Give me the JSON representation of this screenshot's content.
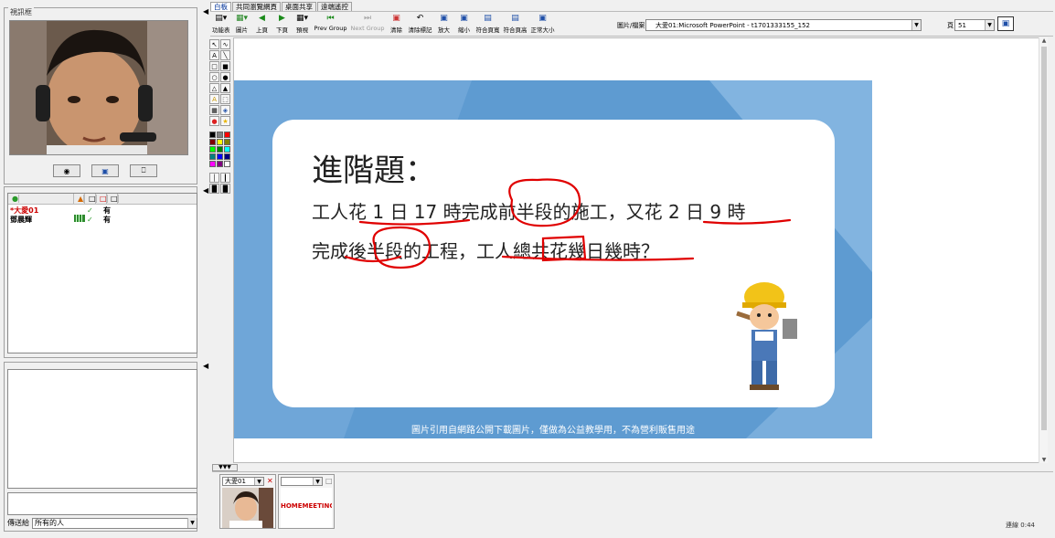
{
  "left": {
    "video_title": "視訊框",
    "users_header": [
      "",
      "",
      "",
      ""
    ],
    "users": [
      {
        "name": "*大愛01",
        "status": "有",
        "color": "#cc0000"
      },
      {
        "name": "鄧晨輝",
        "status": "有",
        "color": "#000000"
      }
    ],
    "to_label": "傳送給",
    "to_value": "所有的人"
  },
  "tabs": [
    {
      "label": "白板",
      "active": true
    },
    {
      "label": "共同瀏覽網頁",
      "active": false
    },
    {
      "label": "桌面共享",
      "active": false
    },
    {
      "label": "遠端遙控",
      "active": false
    }
  ],
  "toolbar": {
    "buttons": [
      {
        "label": "功能表",
        "icon": "menu-icon",
        "disabled": false
      },
      {
        "label": "圖片",
        "icon": "image-icon",
        "disabled": false
      },
      {
        "label": "上頁",
        "icon": "prev-page-icon",
        "disabled": false
      },
      {
        "label": "下頁",
        "icon": "next-page-icon",
        "disabled": false
      },
      {
        "label": "預視",
        "icon": "preview-icon",
        "disabled": false
      },
      {
        "label": "Prev Group",
        "icon": "prev-group-icon",
        "disabled": false
      },
      {
        "label": "Next Group",
        "icon": "next-group-icon",
        "disabled": true
      },
      {
        "label": "清除",
        "icon": "clear-icon",
        "disabled": false
      },
      {
        "label": "清除標記",
        "icon": "clear-marks-icon",
        "disabled": false
      },
      {
        "label": "放大",
        "icon": "zoom-in-icon",
        "disabled": false
      },
      {
        "label": "縮小",
        "icon": "zoom-out-icon",
        "disabled": false
      },
      {
        "label": "符合頁寬",
        "icon": "fit-width-icon",
        "disabled": false
      },
      {
        "label": "符合頁高",
        "icon": "fit-height-icon",
        "disabled": false
      },
      {
        "label": "正常大小",
        "icon": "actual-size-icon",
        "disabled": false
      }
    ],
    "file_label": "圖片/檔案",
    "file_value": "大愛01:Microsoft PowerPoint - t1701333155_152",
    "page_label": "頁",
    "page_value": "51"
  },
  "slide": {
    "title": "進階題：",
    "line1": "工人花 1 日 17 時完成前半段的施工，又花 2 日 9 時",
    "line2": "完成後半段的工程，工人總共花幾日幾時？",
    "footer": "圖片引用自網路公開下載圖片，僅做為公益教學用，不為營利販售用途"
  },
  "thumbs": [
    {
      "select": "大愛01",
      "img_caption": ""
    },
    {
      "select": "",
      "img_caption": "HOMEMEETING"
    }
  ],
  "status_text": "連線 0:44",
  "colors": {
    "slide_bg": "#5e9bd1",
    "annotation_red": "#e00000",
    "title_tab": "#003399"
  }
}
